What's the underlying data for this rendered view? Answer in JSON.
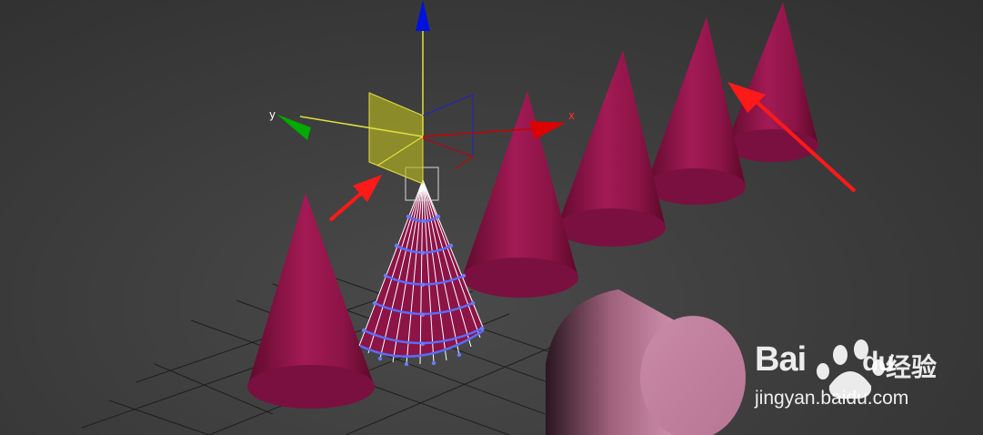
{
  "viewport": {
    "background": "#3a3a3a",
    "grid_color": "#1c1c1c",
    "object_color": "#8c1446",
    "selected_wire_color": "#ffffff",
    "selected_vertex_color": "#5a6cff",
    "cylinder_color": "#c88aa6",
    "annotation_arrow_color": "#ff1a1a"
  },
  "gizmo": {
    "x_label": "x",
    "y_label": "y",
    "x_color": "#cc0000",
    "y_color": "#00aa00",
    "z_color": "#0011dd",
    "plane_color": "#b5b521"
  },
  "watermark": {
    "brand_left": "Bai",
    "brand_right": "du",
    "brand_cn": "经验",
    "url": "jingyan.baidu.com"
  }
}
